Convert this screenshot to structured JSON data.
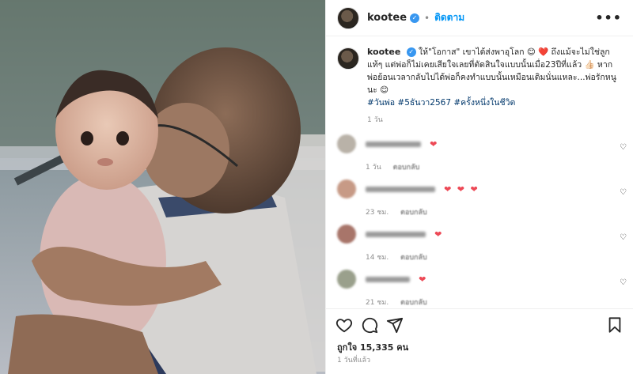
{
  "post": {
    "username": "kootee",
    "follow_label": "ติดตาม",
    "more_label": "•••"
  },
  "caption": {
    "username": "kootee",
    "text": "ให้\"โอกาส\" เขาได้ส่งพาอุโลก 😊 ❤️ ถึงแม้จะไม่ใช่ลูกแท้ๆ แต่พ่อก็ไม่เคยเสียใจเลยที่ตัดสินใจแบบนั้นเมื่อ23ปีที่แล้ว 👍🏻 หากพ่อย้อนเวลากลับไปได้พ่อก็คงทำแบบนั้นเหมือนเดิมนั่นแหละ...พ่อรักหนูนะ 😊",
    "hashtags": "#วันพ่อ #5ธันวา2567 #ครั้งหนึ่งในชีวิต",
    "time": "1 วัน"
  },
  "comments": [
    {
      "hearts": "❤",
      "time": "1 วัน",
      "reply": "ตอบกลับ",
      "avatar_color": "#b9b2a8"
    },
    {
      "hearts": "❤ ❤ ❤",
      "time": "23 ชม.",
      "reply": "ตอบกลับ",
      "avatar_color": "#c79a86"
    },
    {
      "hearts": "❤",
      "time": "14 ชม.",
      "reply": "ตอบกลับ",
      "avatar_color": "#a8756a"
    },
    {
      "hearts": "❤",
      "time": "21 ชม.",
      "reply": "ตอบกลับ",
      "avatar_color": "#9aa08c"
    },
    {
      "hearts": "❤ ❤",
      "time": "",
      "reply": "",
      "avatar_color": "#b5a6a4"
    }
  ],
  "likes_text": "ถูกใจ 15,335 คน",
  "date_text": "1 วันที่แล้ว",
  "colors": {
    "accent": "#0095f6",
    "heart": "#ed4956",
    "verified": "#3897f0"
  },
  "icons": [
    "heart-icon",
    "comment-icon",
    "share-icon",
    "bookmark-icon",
    "verified-icon",
    "more-icon"
  ]
}
